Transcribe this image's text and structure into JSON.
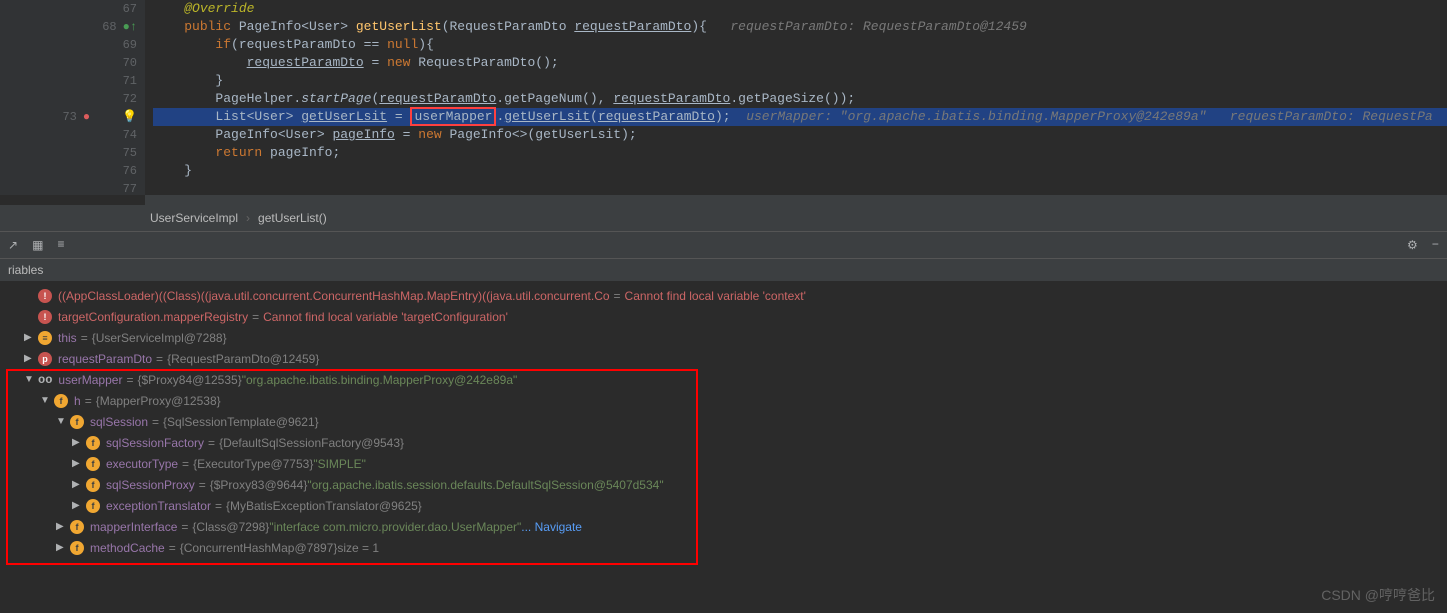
{
  "code": {
    "lines": [
      {
        "num": "67",
        "html": "    <span class='annotation'>@Override</span>"
      },
      {
        "num": "68",
        "html": "    <span class='kw'>public</span> PageInfo&lt;User&gt; <span class='method'>getUserList</span>(RequestParamDto <u>requestParamDto</u>){   <span class='param-hint'>requestParamDto: RequestParamDto@12459</span>",
        "icon": "override"
      },
      {
        "num": "69",
        "html": "        <span class='kw'>if</span>(requestParamDto == <span class='kw'>null</span>){"
      },
      {
        "num": "70",
        "html": "            <u>requestParamDto</u> = <span class='kw'>new</span> RequestParamDto();"
      },
      {
        "num": "71",
        "html": "        }"
      },
      {
        "num": "72",
        "html": "        PageHelper.<span style='font-style:italic'>startPage</span>(<u>requestParamDto</u>.getPageNum(), <u>requestParamDto</u>.getPageSize());"
      },
      {
        "num": "73",
        "html": "        List&lt;User&gt; <u>getUserLsit</u> = <span class='boxed'>userMapper</span>.<u>getUserLsit</u>(<u>requestParamDto</u>);  <span class='param-hint'>userMapper: &quot;org.apache.ibatis.binding.MapperProxy@242e89a&quot;   requestParamDto: RequestPa</span>",
        "current": true,
        "icon": "breakpoint"
      },
      {
        "num": "74",
        "html": "        PageInfo&lt;User&gt; <u>pageInfo</u> = <span class='kw'>new</span> PageInfo&lt;&gt;(getUserLsit);"
      },
      {
        "num": "75",
        "html": "        <span class='kw'>return</span> pageInfo;"
      },
      {
        "num": "76",
        "html": "    }"
      },
      {
        "num": "77",
        "html": ""
      }
    ]
  },
  "breadcrumb": {
    "class": "UserServiceImpl",
    "method": "getUserList()"
  },
  "panel": {
    "title": "riables"
  },
  "variables": [
    {
      "indent": 1,
      "icontype": "error",
      "iconchar": "!",
      "name": "((AppClassLoader)((Class)((java.util.concurrent.ConcurrentHashMap.MapEntry)((java.util.concurrent.Co",
      "val": "Cannot find local variable 'context'",
      "err": true
    },
    {
      "indent": 1,
      "icontype": "error",
      "iconchar": "!",
      "name": "targetConfiguration.mapperRegistry",
      "val": "Cannot find local variable 'targetConfiguration'",
      "err": true
    },
    {
      "indent": 1,
      "icontype": "this",
      "iconchar": "≡",
      "arrow": "▶",
      "name": "this",
      "val": "{UserServiceImpl@7288}"
    },
    {
      "indent": 1,
      "icontype": "p",
      "iconchar": "p",
      "arrow": "▶",
      "name": "requestParamDto",
      "val": "{RequestParamDto@12459}"
    },
    {
      "indent": 1,
      "icontype": "oo",
      "arrow": "▼",
      "name": "userMapper",
      "val": "{$Proxy84@12535}",
      "str": "\"org.apache.ibatis.binding.MapperProxy@242e89a\""
    },
    {
      "indent": 2,
      "icontype": "f",
      "iconchar": "f",
      "arrow": "▼",
      "name": "h",
      "val": "{MapperProxy@12538}"
    },
    {
      "indent": 3,
      "icontype": "f",
      "iconchar": "f",
      "arrow": "▼",
      "name": "sqlSession",
      "val": "{SqlSessionTemplate@9621}"
    },
    {
      "indent": 4,
      "icontype": "f",
      "iconchar": "f",
      "arrow": "▶",
      "name": "sqlSessionFactory",
      "val": "{DefaultSqlSessionFactory@9543}"
    },
    {
      "indent": 4,
      "icontype": "f",
      "iconchar": "f",
      "arrow": "▶",
      "name": "executorType",
      "val": "{ExecutorType@7753}",
      "str": "\"SIMPLE\""
    },
    {
      "indent": 4,
      "icontype": "f",
      "iconchar": "f",
      "arrow": "▶",
      "name": "sqlSessionProxy",
      "val": "{$Proxy83@9644}",
      "str": "\"org.apache.ibatis.session.defaults.DefaultSqlSession@5407d534\""
    },
    {
      "indent": 4,
      "icontype": "f",
      "iconchar": "f",
      "arrow": "▶",
      "name": "exceptionTranslator",
      "val": "{MyBatisExceptionTranslator@9625}"
    },
    {
      "indent": 3,
      "icontype": "f",
      "iconchar": "f",
      "arrow": "▶",
      "name": "mapperInterface",
      "val": "{Class@7298}",
      "str": "\"interface com.micro.provider.dao.UserMapper\"",
      "navigate": true
    },
    {
      "indent": 3,
      "icontype": "f",
      "iconchar": "f",
      "arrow": "▶",
      "name": "methodCache",
      "val": "{ConcurrentHashMap@7897}",
      "extra": " size = 1"
    }
  ],
  "watermark": "CSDN @哼哼爸比",
  "navigate_label": "... Navigate"
}
